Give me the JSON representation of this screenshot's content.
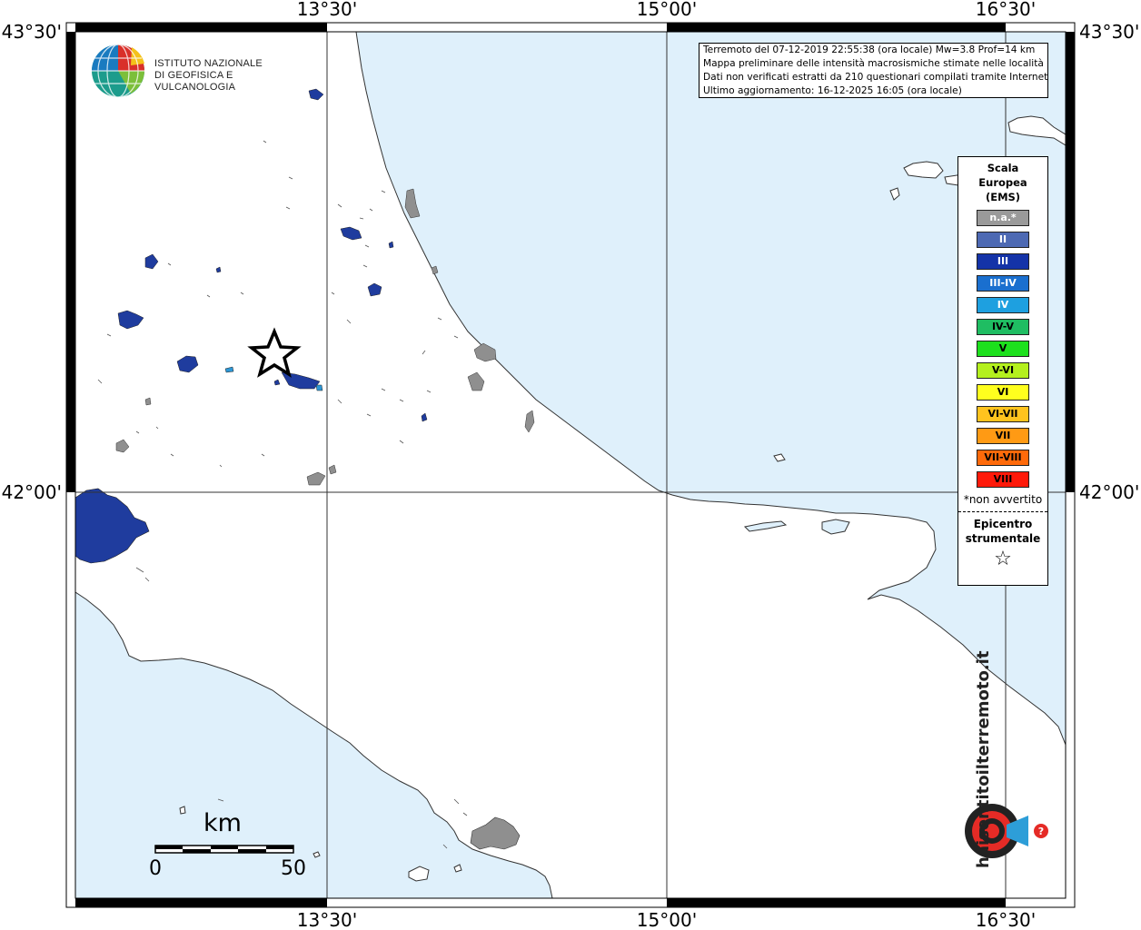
{
  "map": {
    "grid_lon_labels": [
      "13°30'",
      "15°00'",
      "16°30'"
    ],
    "grid_lat_labels": [
      "43°30'",
      "42°00'"
    ],
    "colors": {
      "sea": "#dff0fb",
      "land": "#ffffff",
      "coast": "#333333",
      "not_felt": "#8f8f8f",
      "intensity_III": "#1f3c9e",
      "intensity_IV": "#2d97d6"
    }
  },
  "info_box": {
    "line1": "Terremoto del 07-12-2019 22:55:38 (ora locale) Mw=3.8 Prof=14 km",
    "line2": "Mappa preliminare delle intensità macrosismiche stimate nelle località",
    "line3": "Dati non verificati estratti da 210 questionari compilati tramite Internet.",
    "line4": "Ultimo aggiornamento: 16-12-2025 16:05 (ora locale)"
  },
  "legend": {
    "title_line1": "Scala",
    "title_line2": "Europea",
    "title_line3": "(EMS)",
    "items": [
      {
        "label": "n.a.*",
        "color": "#9a9a9a",
        "text_color": "#ffffff"
      },
      {
        "label": "II",
        "color": "#4d69b3",
        "text_color": "#ffffff"
      },
      {
        "label": "III",
        "color": "#1433a8",
        "text_color": "#ffffff"
      },
      {
        "label": "III-IV",
        "color": "#1a6fcf",
        "text_color": "#ffffff"
      },
      {
        "label": "IV",
        "color": "#1ea0e0",
        "text_color": "#ffffff"
      },
      {
        "label": "IV-V",
        "color": "#1fbd62",
        "text_color": "#000000"
      },
      {
        "label": "V",
        "color": "#1de01d",
        "text_color": "#000000"
      },
      {
        "label": "V-VI",
        "color": "#b4f01e",
        "text_color": "#000000"
      },
      {
        "label": "VI",
        "color": "#ffff1e",
        "text_color": "#000000"
      },
      {
        "label": "VI-VII",
        "color": "#ffc31e",
        "text_color": "#000000"
      },
      {
        "label": "VII",
        "color": "#ff9a14",
        "text_color": "#000000"
      },
      {
        "label": "VII-VIII",
        "color": "#ff6a0a",
        "text_color": "#000000"
      },
      {
        "label": "VIII",
        "color": "#ff1a0a",
        "text_color": "#000000"
      }
    ],
    "footnote": "*non avvertito",
    "epicenter_line1": "Epicentro",
    "epicenter_line2": "strumentale",
    "epicenter_symbol": "☆"
  },
  "logo": {
    "line1": "ISTITUTO NAZIONALE",
    "line2": "DI GEOFISICA E VULCANOLOGIA"
  },
  "scale_bar": {
    "unit": "km",
    "start": "0",
    "end": "50"
  },
  "badge": {
    "text": "haisentitoilterremoto.it",
    "url": "www"
  }
}
